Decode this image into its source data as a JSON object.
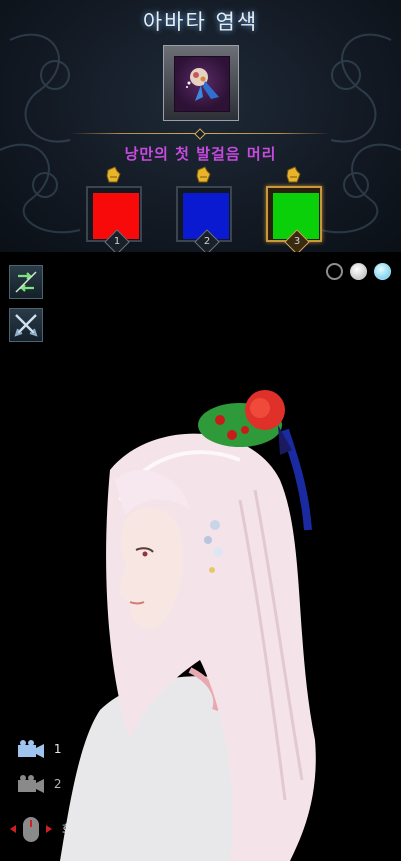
{
  "header": {
    "title": "아바타 염색"
  },
  "item": {
    "name": "낭만의 첫 발걸음 머리"
  },
  "dye_slots": [
    {
      "number": "1",
      "color": "#f80a0a"
    },
    {
      "number": "2",
      "color": "#0a1ad0"
    },
    {
      "number": "3",
      "color": "#0ad00a",
      "selected": true
    }
  ],
  "colors": {
    "title_glow": "#6fb6ff",
    "item_name": "#c84be0",
    "gold_frame": "#c9973e"
  },
  "toolbar": {
    "icons": [
      "swap-icon",
      "crossed-swords-icon"
    ]
  },
  "background_options": [
    "#000000",
    "#ffffff",
    "#5cc6ee"
  ],
  "camera": {
    "items": [
      {
        "label": "1"
      },
      {
        "label": "2"
      }
    ],
    "rotate_label": "회전"
  }
}
